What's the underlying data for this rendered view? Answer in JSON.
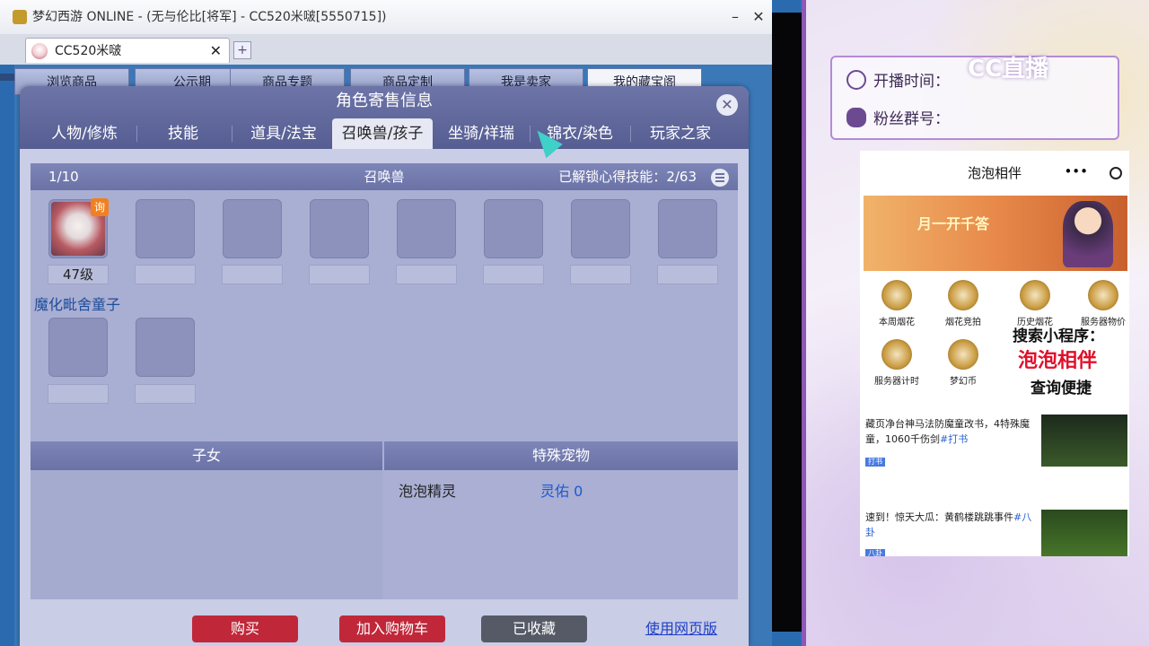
{
  "window": {
    "title": "梦幻西游 ONLINE - (无与伦比[将军] - CC520米啵[5550715])",
    "minimize": "–",
    "close": "✕"
  },
  "browser_tab": {
    "label": "CC520米啵",
    "close": "✕",
    "new_tab": "+"
  },
  "bg_nav": [
    "浏览商品",
    "公示期",
    "商品专题",
    "商品定制",
    "我是卖家",
    "我的藏宝阁"
  ],
  "dialog": {
    "title": "角色寄售信息",
    "close": "✕",
    "tabs": [
      "人物/修炼",
      "技能",
      "道具/法宝",
      "召唤兽/孩子",
      "坐骑/祥瑞",
      "锦衣/染色",
      "玩家之家"
    ],
    "active_tab": 3
  },
  "pets_panel": {
    "count": "1/10",
    "title": "召唤兽",
    "unlock_label": "已解锁心得技能：",
    "unlock_value": "2/63",
    "pet": {
      "badge": "询",
      "level": "47级",
      "name": "魔化毗舍童子"
    }
  },
  "children_section": {
    "title": "子女"
  },
  "special_section": {
    "title": "特殊宠物",
    "pet_name": "泡泡精灵",
    "stat_label": "灵佑",
    "stat_value": "0"
  },
  "buttons": {
    "buy": "购买",
    "add_cart": "加入购物车",
    "favorited": "已收藏",
    "web_version": "使用网页版"
  },
  "colors": {
    "buy": "#c0283a",
    "add_cart": "#c0283a",
    "favorited": "#555a66",
    "frame": "#8f57b8"
  },
  "stream_info": {
    "start_label": "开播时间：",
    "fans_label": "粉丝群号：",
    "logo": "CC直播"
  },
  "phone_ad": {
    "title": "泡泡相伴",
    "more": "•••",
    "banner": "月一开千答",
    "grid": [
      "本周烟花",
      "烟花竞拍",
      "历史烟花",
      "服务器物价",
      "服务器计时",
      "梦幻币"
    ],
    "search_line": "搜索小程序：",
    "app_name": "泡泡相伴",
    "slogan": "查询便捷",
    "news": [
      {
        "text": "藏页净台神马法防魔童改书，4特殊魔童，1060千伤剑",
        "tag": "#打书",
        "chip": "打书"
      },
      {
        "text": "速到！惊天大瓜：黄鹤楼跳跳事件",
        "tag": "#八卦",
        "chip": "八卦"
      }
    ]
  }
}
